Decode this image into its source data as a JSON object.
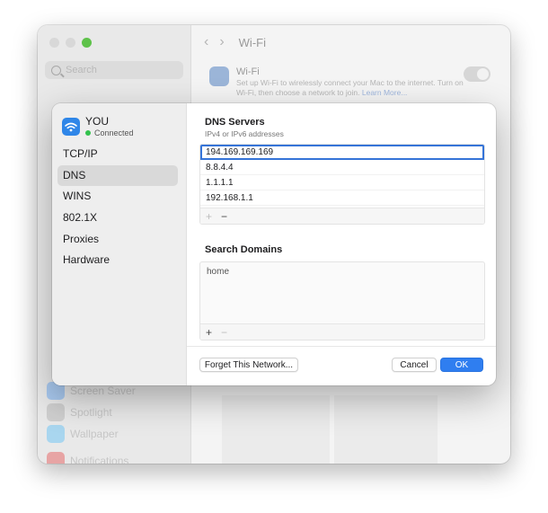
{
  "background_window": {
    "search_placeholder": "Search",
    "title": "Wi-Fi",
    "nav_back": "‹",
    "nav_forward": "›",
    "wifi_title": "Wi-Fi",
    "wifi_desc": "Set up Wi-Fi to wirelessly connect your Mac to the internet. Turn on Wi-Fi, then choose a network to join.",
    "wifi_link": "Learn More...",
    "sidebar_items": [
      "Screen Saver",
      "Spotlight",
      "Wallpaper",
      "Notifications"
    ],
    "sidebar_colors": [
      "#a9c9ef",
      "#cfcfcf",
      "#a9d6ef",
      "#e7a4a4"
    ]
  },
  "network": {
    "name": "YOU",
    "status": "Connected",
    "status_color": "#33c24d",
    "icon": "wifi-icon"
  },
  "sidebar": {
    "items": [
      "TCP/IP",
      "DNS",
      "WINS",
      "802.1X",
      "Proxies",
      "Hardware"
    ],
    "selected": "DNS"
  },
  "dns": {
    "title": "DNS Servers",
    "subtitle": "IPv4 or IPv6 addresses",
    "servers": [
      "194.169.169.169",
      "8.8.4.4",
      "1.1.1.1",
      "192.168.1.1"
    ],
    "add_label": "+",
    "remove_label": "−"
  },
  "search_domains": {
    "title": "Search Domains",
    "items": [
      "home"
    ],
    "add_label": "+",
    "remove_label": "−"
  },
  "buttons": {
    "forget": "Forget This Network...",
    "cancel": "Cancel",
    "ok": "OK"
  },
  "colors": {
    "accent": "#2f7ef0",
    "wifi_icon_bg": "#2f86e8"
  }
}
